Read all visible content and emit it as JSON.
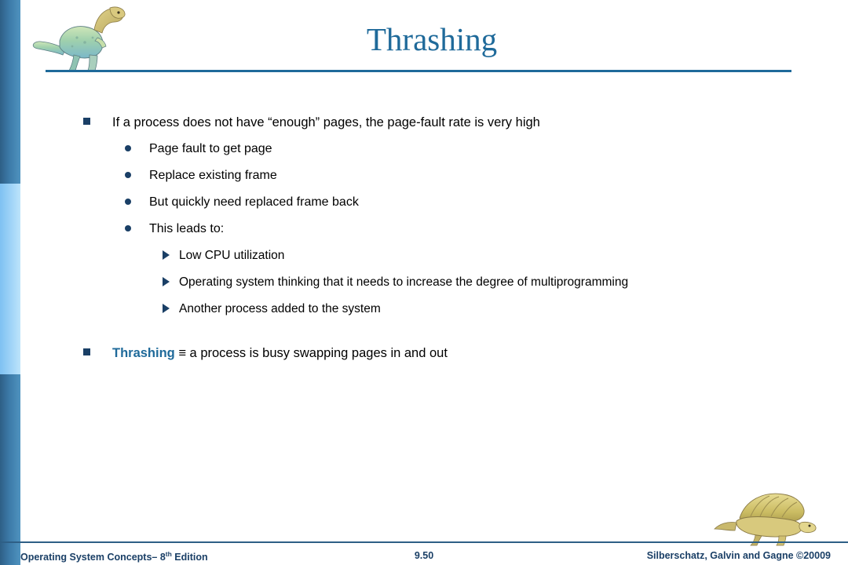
{
  "slide": {
    "title": "Thrashing",
    "bullets": [
      {
        "level": 1,
        "marker": "square",
        "text": "If a process does not have “enough” pages, the page-fault rate is very high"
      },
      {
        "level": 2,
        "marker": "disc",
        "text": "Page fault to get page"
      },
      {
        "level": 2,
        "marker": "disc",
        "text": "Replace existing frame"
      },
      {
        "level": 2,
        "marker": "disc",
        "text": "But quickly need replaced frame back"
      },
      {
        "level": 2,
        "marker": "disc",
        "text": "This leads to:"
      },
      {
        "level": 3,
        "marker": "arrow",
        "text": "Low CPU utilization"
      },
      {
        "level": 3,
        "marker": "arrow",
        "text": "Operating system thinking that it needs to increase the degree of multiprogramming"
      },
      {
        "level": 3,
        "marker": "arrow",
        "text": "Another process added to the system"
      }
    ],
    "thrashing_line": {
      "term": "Thrashing",
      "rest": " ≡ a process is busy swapping pages in and out"
    }
  },
  "footer": {
    "left_text": "Operating System Concepts– 8",
    "left_sup": "th",
    "left_tail": " Edition",
    "page_number": "9.50",
    "right_text": "Silberschatz, Galvin and Gagne ©20009"
  },
  "graphics": {
    "top_dino_name": "dinosaur-illustration",
    "bottom_dino_name": "dinosaur-illustration"
  },
  "colors": {
    "accent": "#1f6a9a",
    "dark_blue": "#1a3f66",
    "light_blue": "#7ec1f2"
  }
}
